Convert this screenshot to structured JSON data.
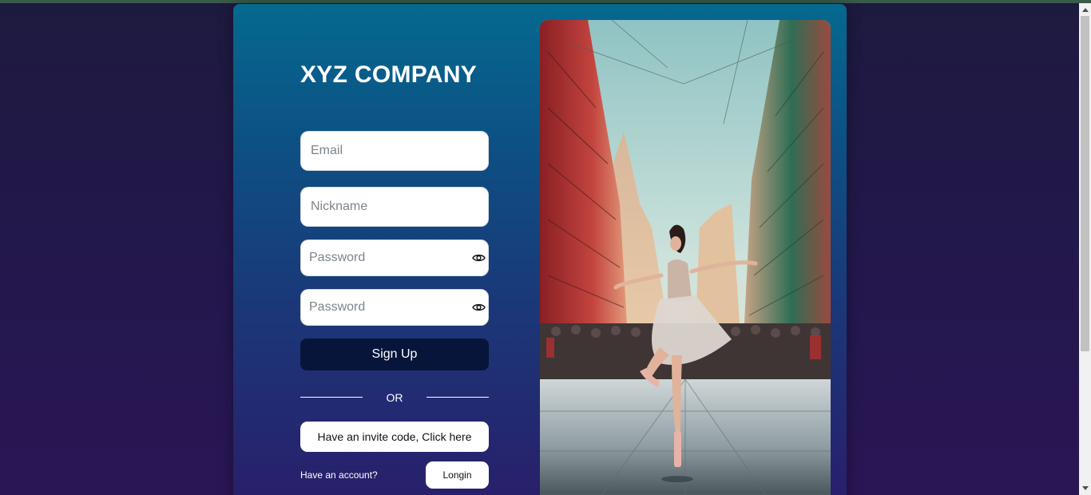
{
  "brand": {
    "name": "XYZ COMPANY"
  },
  "form": {
    "email_placeholder": "Email",
    "nickname_placeholder": "Nickname",
    "password_placeholder": "Password",
    "confirm_password_placeholder": "Password",
    "signup_label": "Sign Up",
    "divider_label": "OR",
    "invite_label": "Have an invite code, Click here",
    "have_account_label": "Have an account?",
    "login_label": "Longin"
  },
  "icons": {
    "password_toggle": "eye-icon",
    "confirm_password_toggle": "eye-icon"
  },
  "colors": {
    "card_top": "#05698f",
    "card_bottom": "#2a1d6a",
    "signup_button": "#07153a",
    "page_background": "#1d1a3f"
  }
}
